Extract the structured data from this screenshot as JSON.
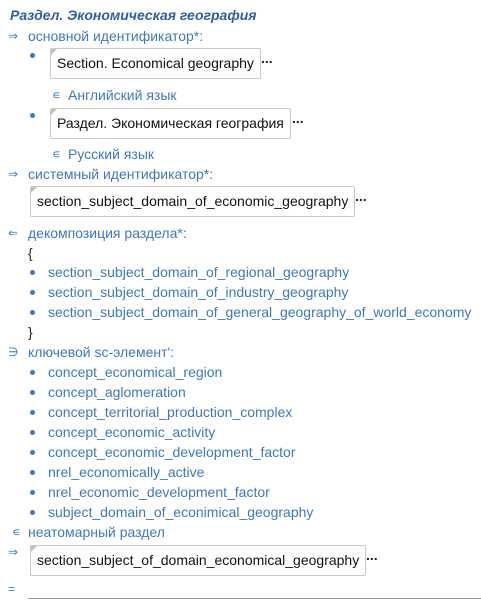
{
  "title": "Раздел. Экономическая география",
  "symbols": {
    "eq_arrow": "⇒",
    "eq_arrow_left": "⇐",
    "ni": "∋",
    "in": "∊",
    "eq": "="
  },
  "identifier": {
    "label": "основной идентификатор*:",
    "entries": [
      {
        "value": "Section. Economical geography",
        "language": "Английский язык"
      },
      {
        "value": "Раздел. Экономическая география",
        "language": "Русский язык"
      }
    ]
  },
  "system_identifier": {
    "label": "системный идентификатор*:",
    "value": "section_subject_domain_of_economic_geography"
  },
  "decomposition": {
    "label": "декомпозиция раздела*:",
    "open_brace": "{",
    "close_brace": "}",
    "items": [
      "section_subject_domain_of_regional_geography",
      "section_subject_domain_of_industry_geography",
      "section_subject_domain_of_general_geography_of_world_economy"
    ]
  },
  "key_elements": {
    "label": "ключевой sc-элемент':",
    "items": [
      "concept_economical_region",
      "concept_aglomeration",
      "concept_territorial_production_complex",
      "concept_economic_activity",
      "concept_economic_development_factor",
      "nrel_economically_active",
      "nrel_economic_development_factor",
      "subject_domain_of_econimical_geography"
    ]
  },
  "non_atomic": {
    "label": "неатомарный раздел"
  },
  "parent": {
    "value": "section_subject_of_domain_economical_geography"
  },
  "more_label": "..."
}
